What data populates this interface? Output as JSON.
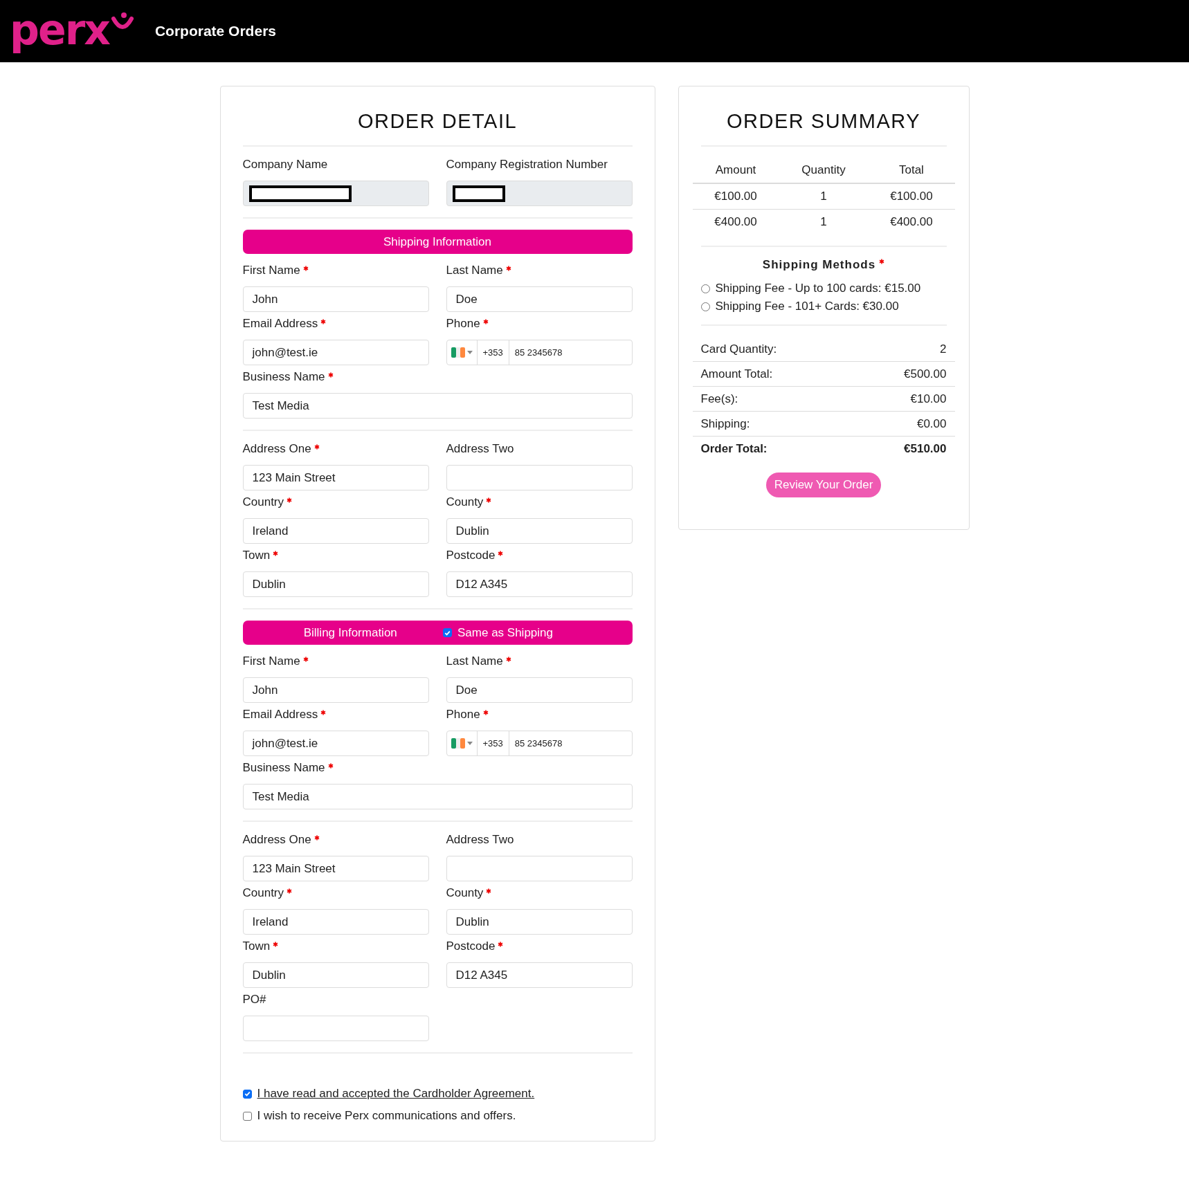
{
  "header": {
    "logo": "perx",
    "title": "Corporate Orders"
  },
  "order_detail": {
    "title": "ORDER DETAIL",
    "company_fields": [
      {
        "label": "Company Name",
        "kind": "redacted",
        "disabled": true
      },
      {
        "label": "Company Registration Number",
        "kind": "redacted",
        "disabled": true
      }
    ],
    "sections": [
      {
        "title": "Shipping Information",
        "groups": [
          [
            {
              "label": "First Name",
              "required": true,
              "kind": "text",
              "value": "John"
            },
            {
              "label": "Last Name",
              "required": true,
              "kind": "text",
              "value": "Doe"
            },
            {
              "label": "Email Address",
              "required": true,
              "kind": "text",
              "value": "john@test.ie"
            },
            {
              "label": "Phone",
              "required": true,
              "kind": "phone",
              "dial_code": "+353",
              "value": "85 2345678"
            },
            {
              "label": "Business Name",
              "required": true,
              "kind": "text",
              "wide": true,
              "value": "Test Media"
            }
          ],
          [
            {
              "label": "Address One",
              "required": true,
              "kind": "text",
              "value": "123 Main Street"
            },
            {
              "label": "Address Two",
              "required": false,
              "kind": "text"
            },
            {
              "label": "Country",
              "required": true,
              "kind": "text",
              "value": "Ireland"
            },
            {
              "label": "County",
              "required": true,
              "kind": "text",
              "value": "Dublin"
            },
            {
              "label": "Town",
              "required": true,
              "kind": "text",
              "value": "Dublin"
            },
            {
              "label": "Postcode",
              "required": true,
              "kind": "text",
              "value": "D12 A345"
            }
          ]
        ]
      },
      {
        "title": "Billing Information",
        "same_as_shipping": {
          "label": "Same as Shipping",
          "checked": true
        },
        "groups": [
          [
            {
              "label": "First Name",
              "required": true,
              "kind": "text",
              "value": "John"
            },
            {
              "label": "Last Name",
              "required": true,
              "kind": "text",
              "value": "Doe"
            },
            {
              "label": "Email Address",
              "required": true,
              "kind": "text",
              "value": "john@test.ie"
            },
            {
              "label": "Phone",
              "required": true,
              "kind": "phone",
              "dial_code": "+353",
              "value": "85 2345678"
            },
            {
              "label": "Business Name",
              "required": true,
              "kind": "text",
              "wide": true,
              "value": "Test Media"
            }
          ],
          [
            {
              "label": "Address One",
              "required": true,
              "kind": "text",
              "value": "123 Main Street"
            },
            {
              "label": "Address Two",
              "required": false,
              "kind": "text"
            },
            {
              "label": "Country",
              "required": true,
              "kind": "text",
              "value": "Ireland"
            },
            {
              "label": "County",
              "required": true,
              "kind": "text",
              "value": "Dublin"
            },
            {
              "label": "Town",
              "required": true,
              "kind": "text",
              "value": "Dublin"
            },
            {
              "label": "Postcode",
              "required": true,
              "kind": "text",
              "value": "D12 A345"
            },
            {
              "label": "PO#",
              "required": false,
              "kind": "text"
            }
          ]
        ]
      }
    ],
    "agreements": [
      {
        "label": "I have read and accepted the Cardholder Agreement.",
        "kind": "link",
        "checked": true
      },
      {
        "label": "I wish to receive Perx communications and offers.",
        "kind": "text",
        "checked": false
      }
    ]
  },
  "order_summary": {
    "title": "ORDER SUMMARY",
    "table": {
      "columns": [
        "Amount",
        "Quantity",
        "Total"
      ],
      "rows": [
        [
          "€100.00",
          "1",
          "€100.00"
        ],
        [
          "€400.00",
          "1",
          "€400.00"
        ]
      ]
    },
    "shipping_methods": {
      "title": "Shipping Methods",
      "required": true,
      "options": [
        {
          "label": "Shipping Fee - Up to 100 cards: €15.00",
          "selected": false
        },
        {
          "label": "Shipping Fee - 101+ Cards: €30.00",
          "selected": false
        }
      ]
    },
    "totals": [
      {
        "label": "Card Quantity:",
        "value": "2",
        "kind": "line"
      },
      {
        "label": "Amount Total:",
        "value": "€500.00",
        "kind": "line"
      },
      {
        "label": "Fee(s):",
        "value": "€10.00",
        "kind": "line"
      },
      {
        "label": "Shipping:",
        "value": "€0.00",
        "kind": "line"
      },
      {
        "label": "Order Total:",
        "value": "€510.00",
        "kind": "total"
      }
    ],
    "button": "Review Your Order"
  }
}
